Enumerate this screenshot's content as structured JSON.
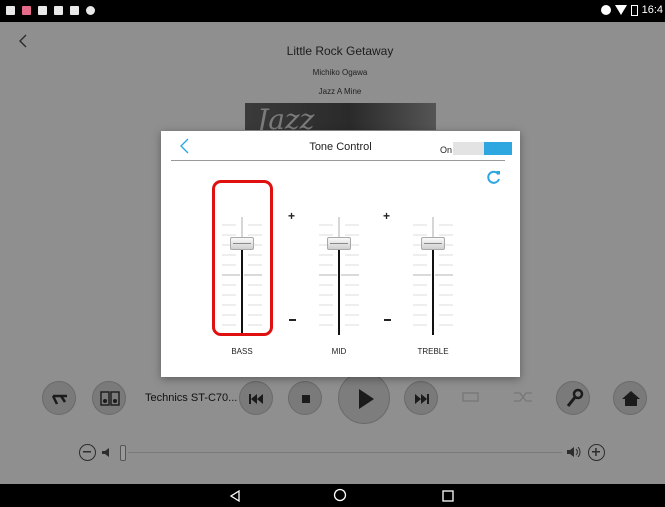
{
  "now_playing": {
    "title": "Little Rock Getaway",
    "artist": "Michiko Ogawa",
    "album": "Jazz A Mine",
    "album_art_text": "Jazz"
  },
  "status_bar": {
    "time": "16:4"
  },
  "player": {
    "device_label": "Technics ST-C70..."
  },
  "volume": {
    "level": 0
  },
  "tone_control": {
    "title": "Tone Control",
    "power_label": "On",
    "power_on": true,
    "plus_label": "+",
    "sliders": [
      {
        "id": "bass",
        "label": "BASS",
        "value": 0.28,
        "highlighted": true
      },
      {
        "id": "mid",
        "label": "MID",
        "value": 0.28
      },
      {
        "id": "treble",
        "label": "TREBLE",
        "value": 0.28
      }
    ]
  },
  "colors": {
    "accent": "#2ea7e0",
    "highlight": "#e01010",
    "dim_background": "#8f8f8f"
  },
  "icons": [
    "back-icon",
    "reset-icon",
    "equalizer-icon",
    "speakers-icon",
    "skip-previous-icon",
    "stop-icon",
    "play-icon",
    "skip-next-icon",
    "repeat-icon",
    "shuffle-icon",
    "wrench-icon",
    "home-icon",
    "volume-minus-icon",
    "volume-plus-icon",
    "nav-back-icon",
    "nav-home-icon",
    "nav-recents-icon"
  ]
}
